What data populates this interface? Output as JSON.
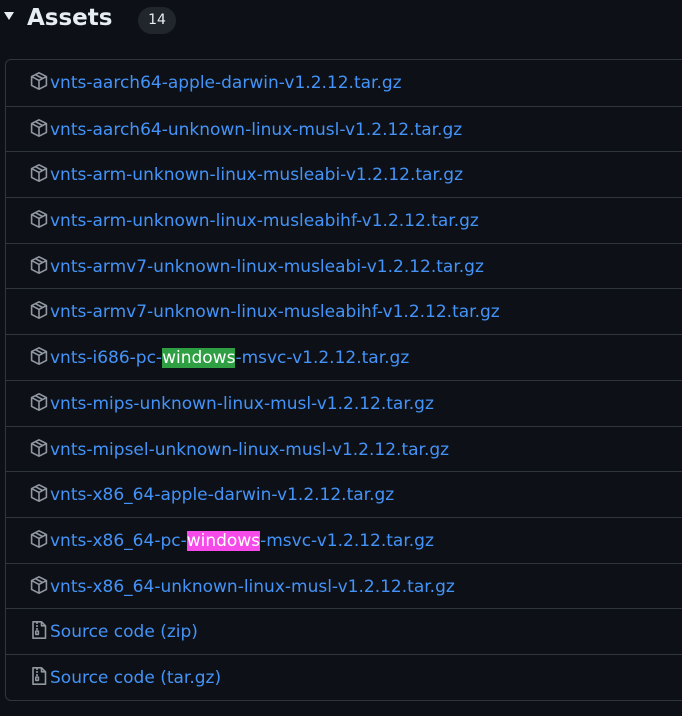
{
  "assets": {
    "title": "Assets",
    "count": "14",
    "items": [
      {
        "icon": "package-icon",
        "prefix": "vnts-aarch64-apple-darwin-v1.2.12.tar.gz",
        "highlight": "",
        "suffix": ""
      },
      {
        "icon": "package-icon",
        "prefix": "vnts-aarch64-unknown-linux-musl-v1.2.12.tar.gz",
        "highlight": "",
        "suffix": ""
      },
      {
        "icon": "package-icon",
        "prefix": "vnts-arm-unknown-linux-musleabi-v1.2.12.tar.gz",
        "highlight": "",
        "suffix": ""
      },
      {
        "icon": "package-icon",
        "prefix": "vnts-arm-unknown-linux-musleabihf-v1.2.12.tar.gz",
        "highlight": "",
        "suffix": ""
      },
      {
        "icon": "package-icon",
        "prefix": "vnts-armv7-unknown-linux-musleabi-v1.2.12.tar.gz",
        "highlight": "",
        "suffix": ""
      },
      {
        "icon": "package-icon",
        "prefix": "vnts-armv7-unknown-linux-musleabihf-v1.2.12.tar.gz",
        "highlight": "",
        "suffix": ""
      },
      {
        "icon": "package-icon",
        "prefix": "vnts-i686-pc-",
        "highlight": "windows",
        "highlight_color": "#2ea043",
        "suffix": "-msvc-v1.2.12.tar.gz"
      },
      {
        "icon": "package-icon",
        "prefix": "vnts-mips-unknown-linux-musl-v1.2.12.tar.gz",
        "highlight": "",
        "suffix": ""
      },
      {
        "icon": "package-icon",
        "prefix": "vnts-mipsel-unknown-linux-musl-v1.2.12.tar.gz",
        "highlight": "",
        "suffix": ""
      },
      {
        "icon": "package-icon",
        "prefix": "vnts-x86_64-apple-darwin-v1.2.12.tar.gz",
        "highlight": "",
        "suffix": ""
      },
      {
        "icon": "package-icon",
        "prefix": "vnts-x86_64-pc-",
        "highlight": "windows",
        "highlight_color": "#f64be8",
        "suffix": "-msvc-v1.2.12.tar.gz"
      },
      {
        "icon": "package-icon",
        "prefix": "vnts-x86_64-unknown-linux-musl-v1.2.12.tar.gz",
        "highlight": "",
        "suffix": ""
      },
      {
        "icon": "file-zip-icon",
        "prefix": "Source code (zip)",
        "highlight": "",
        "suffix": ""
      },
      {
        "icon": "file-zip-icon",
        "prefix": "Source code (tar.gz)",
        "highlight": "",
        "suffix": ""
      }
    ]
  },
  "colors": {
    "background": "#0d1117",
    "border": "#30363d",
    "link": "#4493f8",
    "text": "#e6edf3",
    "icon": "#9198a1"
  }
}
